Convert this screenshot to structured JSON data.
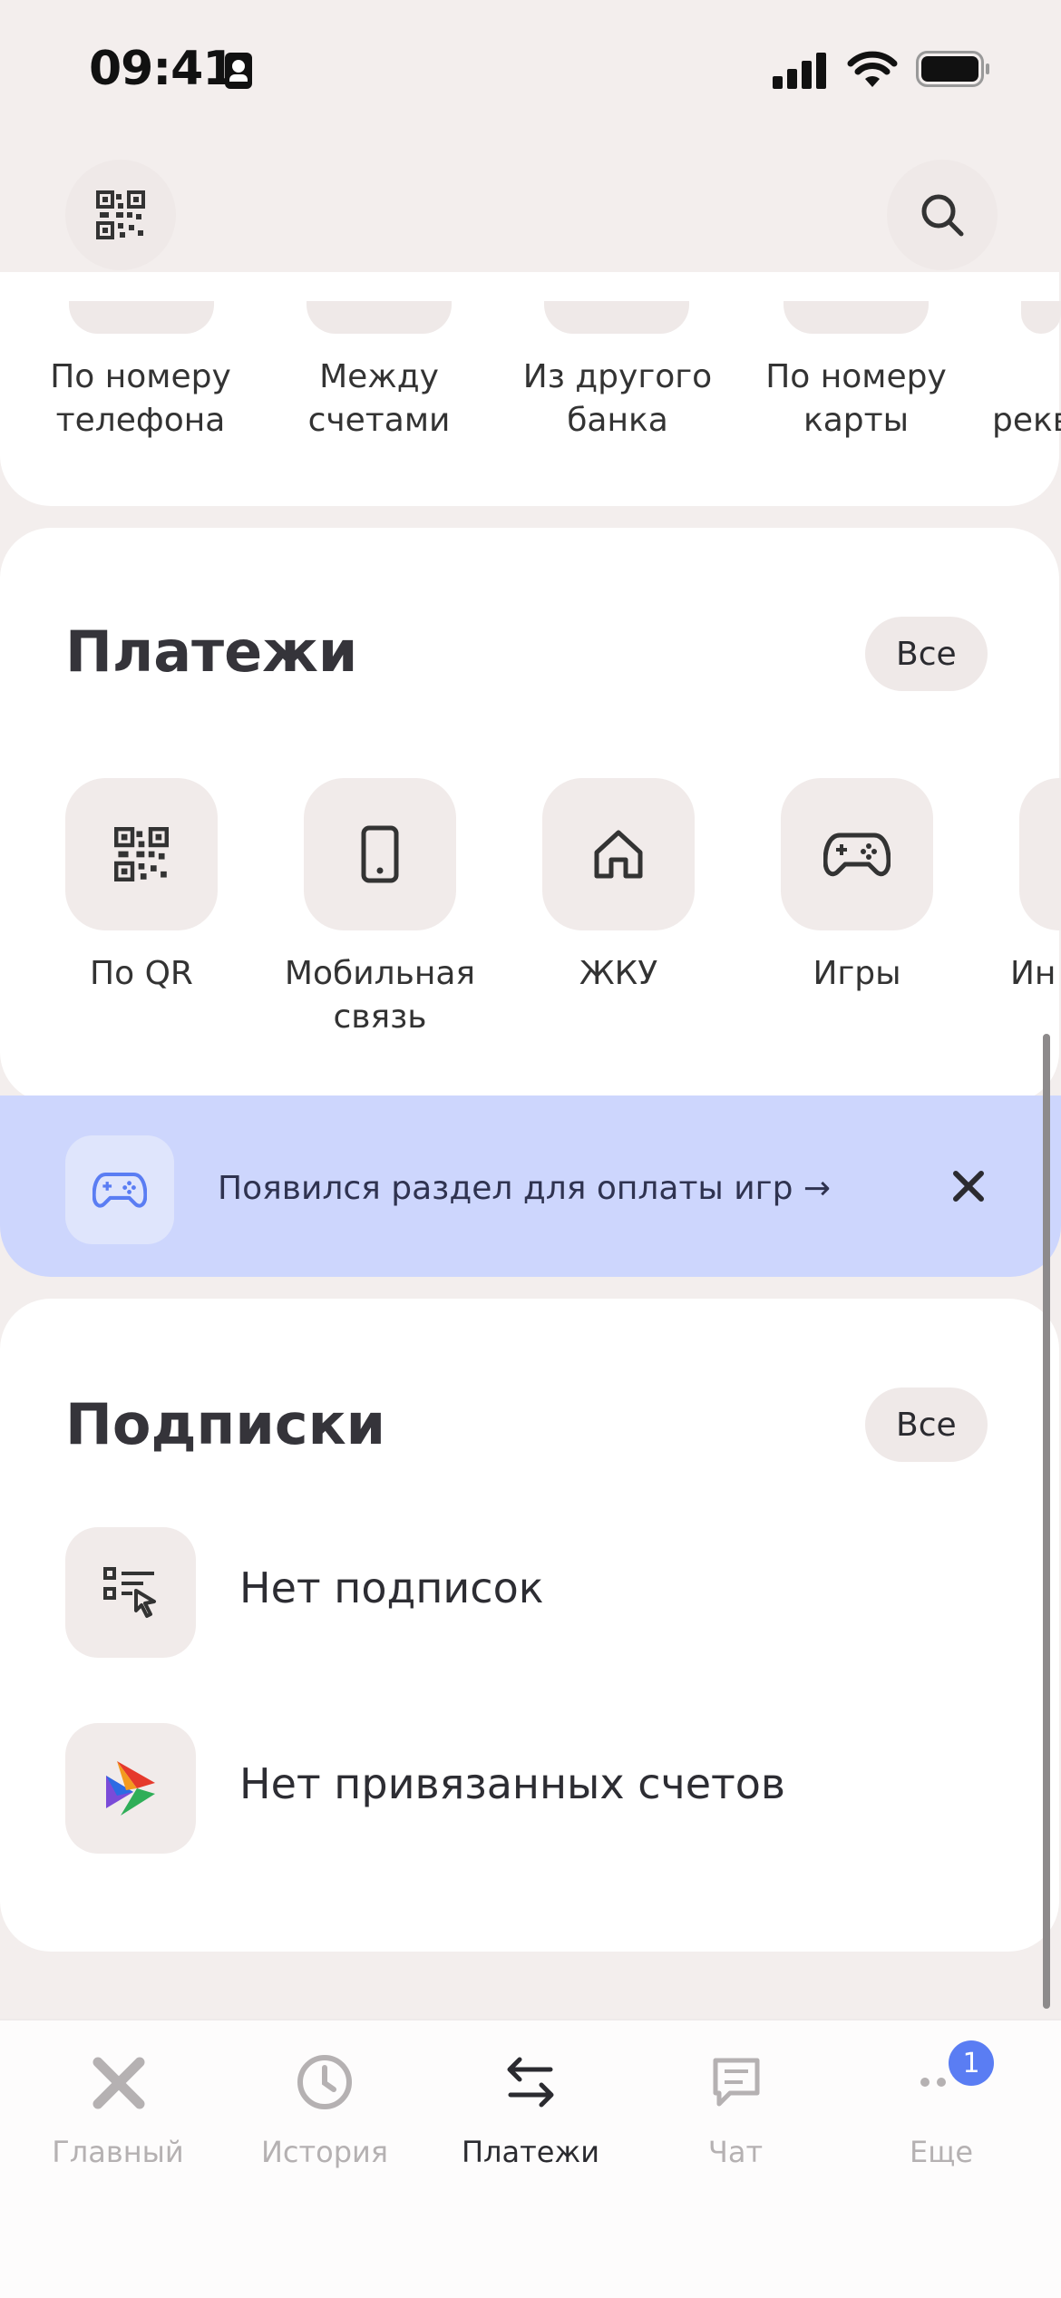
{
  "status_bar": {
    "time": "09:41"
  },
  "transfers": {
    "items": [
      {
        "label_line1": "По номеру",
        "label_line2": "телефона"
      },
      {
        "label_line1": "Между",
        "label_line2": "счетами"
      },
      {
        "label_line1": "Из другого",
        "label_line2": "банка"
      },
      {
        "label_line1": "По номеру",
        "label_line2": "карты"
      },
      {
        "label_line1": "рекв",
        "label_line2": ""
      }
    ]
  },
  "payments": {
    "title": "Платежи",
    "all_label": "Все",
    "items": [
      {
        "icon": "qr-code-icon",
        "label_line1": "По QR",
        "label_line2": ""
      },
      {
        "icon": "mobile-phone-icon",
        "label_line1": "Мобильная",
        "label_line2": "связь"
      },
      {
        "icon": "house-icon",
        "label_line1": "ЖКУ",
        "label_line2": ""
      },
      {
        "icon": "gamepad-icon",
        "label_line1": "Игры",
        "label_line2": ""
      },
      {
        "icon": "internet-icon",
        "label_line1": "Ин",
        "label_line2": ""
      }
    ]
  },
  "banner": {
    "text": "Появился раздел для оплаты игр →",
    "icon": "gamepad-icon",
    "close_icon": "close-icon"
  },
  "subscriptions": {
    "title": "Подписки",
    "all_label": "Все",
    "rows": [
      {
        "icon": "subscription-list-icon",
        "text": "Нет подписок"
      },
      {
        "icon": "colorful-arrows-logo-icon",
        "text": "Нет привязанных счетов"
      }
    ]
  },
  "tabbar": {
    "tabs": [
      {
        "label": "Главный",
        "icon": "home-logo-icon",
        "active": false
      },
      {
        "label": "История",
        "icon": "clock-icon",
        "active": false
      },
      {
        "label": "Платежи",
        "icon": "transfer-arrows-icon",
        "active": true
      },
      {
        "label": "Чат",
        "icon": "chat-icon",
        "active": false
      },
      {
        "label": "Еще",
        "icon": "more-dots-icon",
        "active": false,
        "badge": "1"
      }
    ]
  },
  "colors": {
    "background": "#f3eeed",
    "banner": "#cdd6fd",
    "accent": "#5a7df3",
    "tab_inactive": "#b5b1b2",
    "tab_active": "#2b2b30"
  }
}
